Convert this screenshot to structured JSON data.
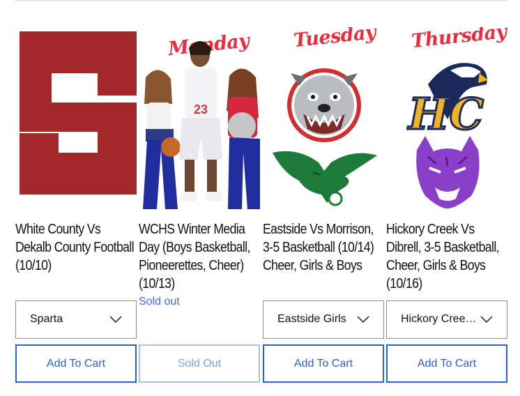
{
  "products": [
    {
      "title": "White County Vs Dekalb County Football (10/10)",
      "select_value": "Sparta",
      "button": "Add To Cart"
    },
    {
      "title": "WCHS Winter Media Day (Boys Basketball, Pioneerettes, Cheer) (10/13)",
      "status": "Sold out",
      "button": "Sold Out"
    },
    {
      "title": "Eastside Vs Morrison, 3-5 Basketball (10/14) Cheer, Girls & Boys",
      "select_value": "Eastside Girls",
      "button": "Add To Cart"
    },
    {
      "title": "Hickory Creek Vs Dibrell, 3-5 Basketball, Cheer, Girls & Boys (10/16)",
      "select_value": "Hickory Creek Girls",
      "button": "Add To Cart"
    }
  ],
  "images": {
    "card2": {
      "banner": "Monday",
      "jersey_number": "23"
    },
    "card3": {
      "banner": "Tuesday"
    },
    "card4": {
      "banner": "Thursday",
      "logo_letters": "HC"
    }
  },
  "colors": {
    "accent": "#2a61d6",
    "sparta_maroon": "#a3282c",
    "banner_red": "#ec2b3c"
  }
}
